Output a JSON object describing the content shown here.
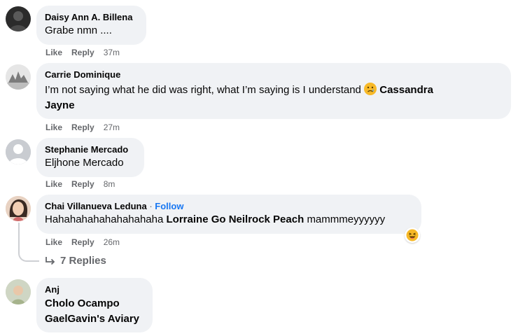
{
  "comments": [
    {
      "author": "Daisy Ann A. Billena",
      "text": "Grabe nmn ....",
      "like": "Like",
      "reply": "Reply",
      "time": "37m"
    },
    {
      "author": "Carrie Dominique",
      "text_pre": "I’m not saying what he did was right, what I’m saying is I understand",
      "emoji": "crying-face",
      "mention_line1": "Cassandra",
      "mention_line2": "Jayne",
      "like": "Like",
      "reply": "Reply",
      "time": "27m"
    },
    {
      "author": "Stephanie Mercado",
      "text": "Eljhone Mercado",
      "like": "Like",
      "reply": "Reply",
      "time": "8m"
    },
    {
      "author": "Chai Villanueva Leduna",
      "separator": "·",
      "follow": "Follow",
      "text_pre": "Hahahahahahahahahaha",
      "mention": "Lorraine Go Neilrock Peach",
      "text_post": "mammmeyyyyyy",
      "reaction": "laughing-reaction",
      "like": "Like",
      "reply": "Reply",
      "time": "26m",
      "replies_label": "7 Replies"
    },
    {
      "author": "Anj",
      "mention_line1": "Cholo Ocampo",
      "mention_line2": "GaelGavin's Aviary"
    }
  ],
  "colors": {
    "bubble": "#f0f2f5",
    "secondary_text": "#65676b",
    "link": "#1877f2"
  }
}
